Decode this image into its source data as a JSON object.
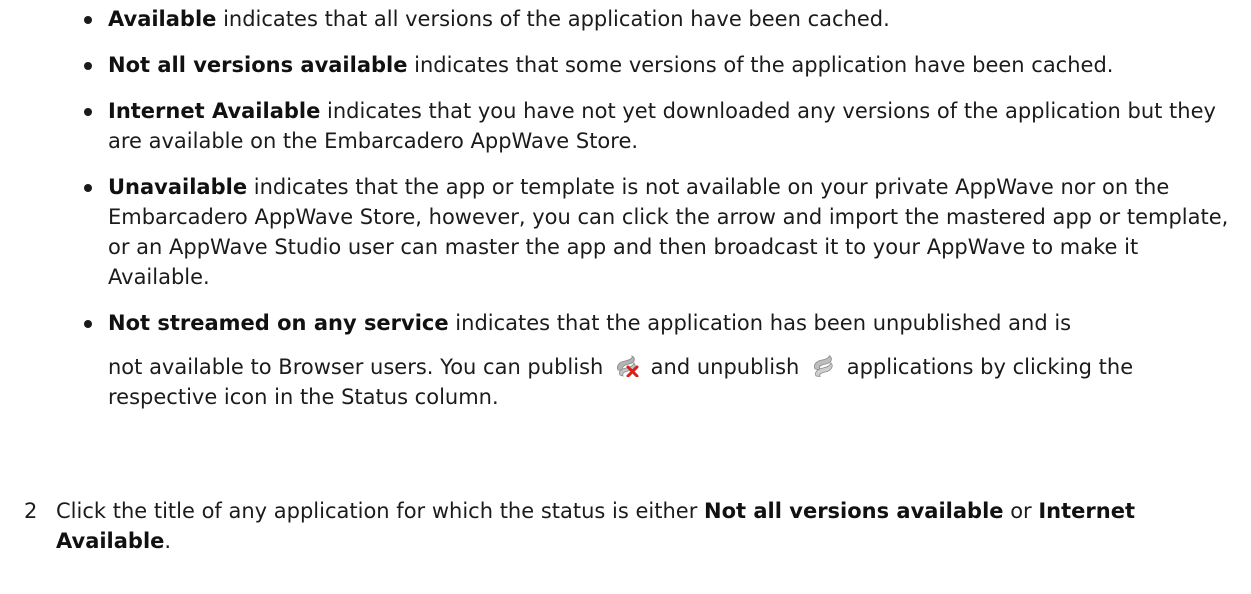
{
  "bullets": [
    {
      "term": "Available",
      "text": " indicates that all versions of the application have been cached."
    },
    {
      "term": "Not all versions available",
      "text": " indicates that some versions of the application have been cached."
    },
    {
      "term": "Internet Available",
      "text": " indicates that you have not yet downloaded any versions of the application but they are available on the Embarcadero AppWave Store."
    },
    {
      "term": "Unavailable",
      "text": " indicates that the app or template is not available on your private AppWave nor on the Embarcadero AppWave Store, however, you can click the arrow and import the mastered app or template, or an AppWave Studio user can master the app and then broadcast it to your AppWave to make it Available."
    },
    {
      "term": "Not streamed on any service",
      "text": " indicates that the application has been unpublished and is",
      "line2_a": "not available to Browser users. You can publish ",
      "line2_b": " and unpublish ",
      "line2_c": " applications by clicking the respective icon in the Status column."
    }
  ],
  "icons": {
    "publish": "publish-icon",
    "unpublish": "unpublish-icon"
  },
  "step": {
    "number": "2",
    "text_a": "Click the title of any application for which the status is either ",
    "term1": "Not all versions available",
    "text_b": " or ",
    "term2": "Internet Available",
    "text_c": "."
  },
  "colors": {
    "text": "#1b1b1b",
    "icon_gray": "#a9a9a9",
    "icon_red_x": "#d8201c"
  }
}
